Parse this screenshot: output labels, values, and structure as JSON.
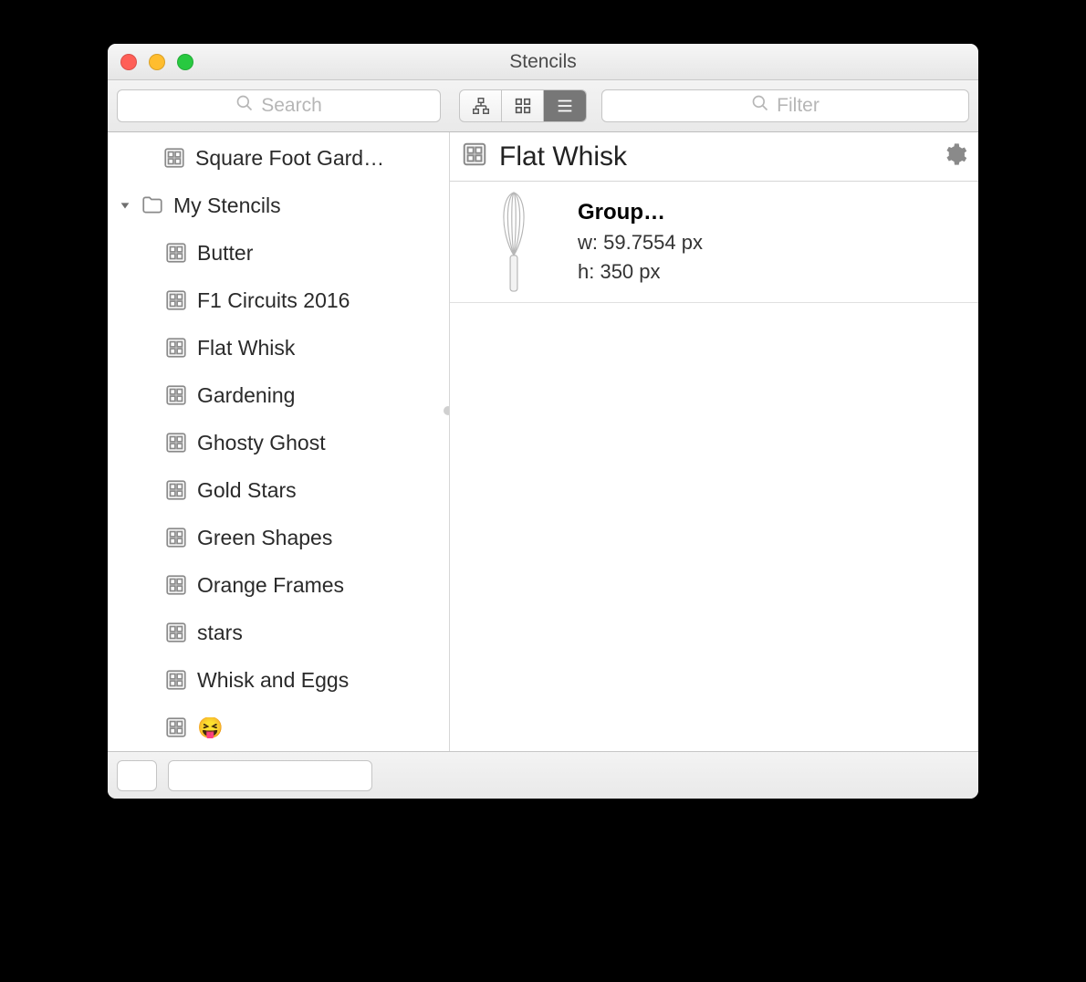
{
  "window": {
    "title": "Stencils"
  },
  "toolbar": {
    "search_placeholder": "Search",
    "filter_placeholder": "Filter",
    "view_mode": "list"
  },
  "sidebar": {
    "top_item": {
      "label": "Square Foot Gard…"
    },
    "folder_label": "My Stencils",
    "items": [
      {
        "label": "Butter"
      },
      {
        "label": "F1 Circuits 2016"
      },
      {
        "label": "Flat Whisk"
      },
      {
        "label": "Gardening"
      },
      {
        "label": "Ghosty Ghost"
      },
      {
        "label": "Gold Stars"
      },
      {
        "label": "Green Shapes"
      },
      {
        "label": "Orange Frames"
      },
      {
        "label": "stars"
      },
      {
        "label": "Whisk and Eggs"
      },
      {
        "label": "😝"
      }
    ]
  },
  "main": {
    "header_name": "Flat Whisk",
    "rows": [
      {
        "title": "Group…",
        "width_label": "w: 59.7554 px",
        "height_label": "h: 350 px"
      }
    ]
  }
}
